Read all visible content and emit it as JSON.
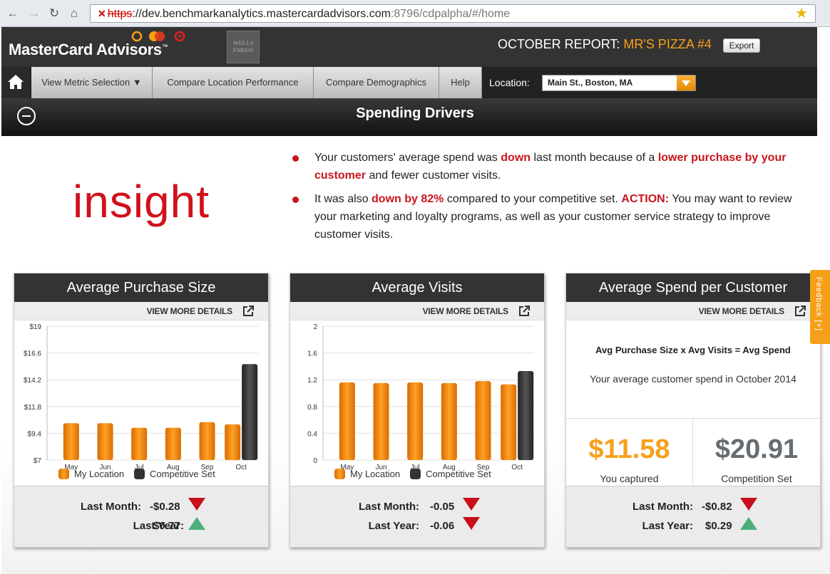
{
  "browser": {
    "url_scheme": "https",
    "url_host": "://dev.benchmarkanalytics.mastercardadvisors.com",
    "url_path": ":8796/cdpalpha/#/home"
  },
  "header": {
    "brand": "MasterCard Advisors",
    "trademark": "™",
    "partner_logo_text": "WELLS FARGO",
    "report_prefix": "OCTOBER REPORT:",
    "report_location": "MR'S PIZZA #4",
    "export_label": "Export"
  },
  "nav": {
    "tabs": [
      {
        "label": "View Metric Selection ▼",
        "width": 170
      },
      {
        "label": "Compare Location Performance",
        "width": 226
      },
      {
        "label": "Compare Demographics",
        "width": 176
      },
      {
        "label": "Help",
        "width": 60
      }
    ],
    "location_label": "Location:",
    "location_value": "Main St., Boston, MA"
  },
  "section": {
    "title": "Spending Drivers"
  },
  "insight": {
    "word": "insight",
    "b1": [
      "Your customers' average spend was ",
      "down",
      " last month because of a ",
      "lower purchase by your customer",
      " and fewer customer visits."
    ],
    "b2": [
      "It was also ",
      "down by 82%",
      " compared to your competitive set. ",
      "ACTION:",
      " You may want to review your marketing and loyalty programs, as well as your customer service strategy to improve customer visits."
    ]
  },
  "colors": {
    "accent": "#f6a01a",
    "red": "#c8151d",
    "competitive": "#3a3a3a",
    "competition_value": "#666e74"
  },
  "panels": {
    "view_more": "VIEW MORE DETAILS",
    "last_month_label": "Last Month:",
    "last_year_label": "Last Year:",
    "legend_my": "My Location",
    "legend_comp": "Competitive Set",
    "purchase": {
      "title": "Average Purchase Size",
      "last_month": "-$0.28",
      "last_month_dir": "down",
      "last_year": "$0.77",
      "last_year_dir": "up"
    },
    "visits": {
      "title": "Average Visits",
      "last_month": "-0.05",
      "last_month_dir": "down",
      "last_year": "-0.06",
      "last_year_dir": "down"
    },
    "spend": {
      "title": "Average Spend per Customer",
      "formula": "Avg Purchase Size x Avg Visits = Avg Spend",
      "note": "Your average customer spend in October 2014",
      "captured_value": "$11.58",
      "captured_label": "You captured",
      "competition_value": "$20.91",
      "competition_label": "Competition Set",
      "last_month": "-$0.82",
      "last_month_dir": "down",
      "last_year": "$0.29",
      "last_year_dir": "up"
    }
  },
  "chart_data": [
    {
      "type": "bar",
      "title": "Average Purchase Size",
      "categories": [
        "May",
        "Jun",
        "Jul",
        "Aug",
        "Sep",
        "Oct"
      ],
      "yticks": [
        "$7",
        "$9.4",
        "$11.8",
        "$14.2",
        "$16.6",
        "$19"
      ],
      "ylim": [
        7,
        19
      ],
      "series": [
        {
          "name": "My Location",
          "values": [
            10.3,
            10.3,
            9.9,
            9.9,
            10.4,
            10.2
          ]
        },
        {
          "name": "Competitive Set",
          "values": [
            null,
            null,
            null,
            null,
            null,
            15.6
          ]
        }
      ]
    },
    {
      "type": "bar",
      "title": "Average Visits",
      "categories": [
        "May",
        "Jun",
        "Jul",
        "Aug",
        "Sep",
        "Oct"
      ],
      "yticks": [
        "0",
        "0.4",
        "0.8",
        "1.2",
        "1.6",
        "2"
      ],
      "ylim": [
        0,
        2
      ],
      "series": [
        {
          "name": "My Location",
          "values": [
            1.16,
            1.15,
            1.16,
            1.15,
            1.18,
            1.13
          ]
        },
        {
          "name": "Competitive Set",
          "values": [
            null,
            null,
            null,
            null,
            null,
            1.33
          ]
        }
      ]
    }
  ]
}
